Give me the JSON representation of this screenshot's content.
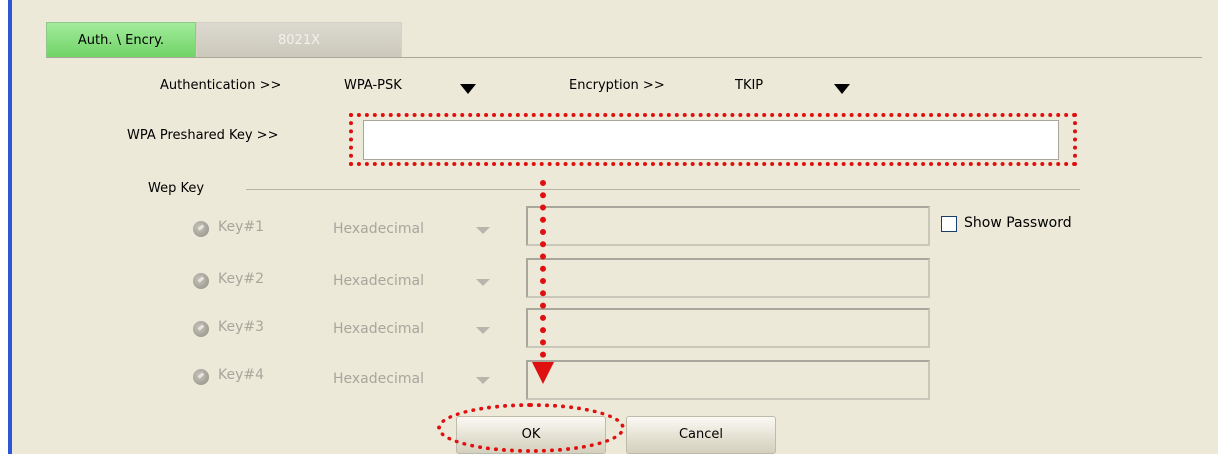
{
  "tabs": [
    {
      "label": "Auth. \\ Encry.",
      "active": true
    },
    {
      "label": "8021X",
      "active": false
    }
  ],
  "authentication": {
    "label": "Authentication >>",
    "value": "WPA-PSK"
  },
  "encryption": {
    "label": "Encryption >>",
    "value": "TKIP"
  },
  "psk": {
    "label": "WPA Preshared Key >>",
    "value": ""
  },
  "wep": {
    "group_label": "Wep Key",
    "keys": [
      {
        "label": "Key#1",
        "format": "Hexadecimal",
        "value": ""
      },
      {
        "label": "Key#2",
        "format": "Hexadecimal",
        "value": ""
      },
      {
        "label": "Key#3",
        "format": "Hexadecimal",
        "value": ""
      },
      {
        "label": "Key#4",
        "format": "Hexadecimal",
        "value": ""
      }
    ]
  },
  "show_password": {
    "label": "Show Password",
    "checked": false
  },
  "buttons": {
    "ok": "OK",
    "cancel": "Cancel"
  },
  "colors": {
    "panel_bg": "#ece9d8",
    "active_tab": "#7fdc74",
    "annotation": "#e01010",
    "left_border": "#2b56d6"
  },
  "icons": {
    "dropdown": "triangle-down-icon",
    "radio": "radio-disabled-icon"
  }
}
